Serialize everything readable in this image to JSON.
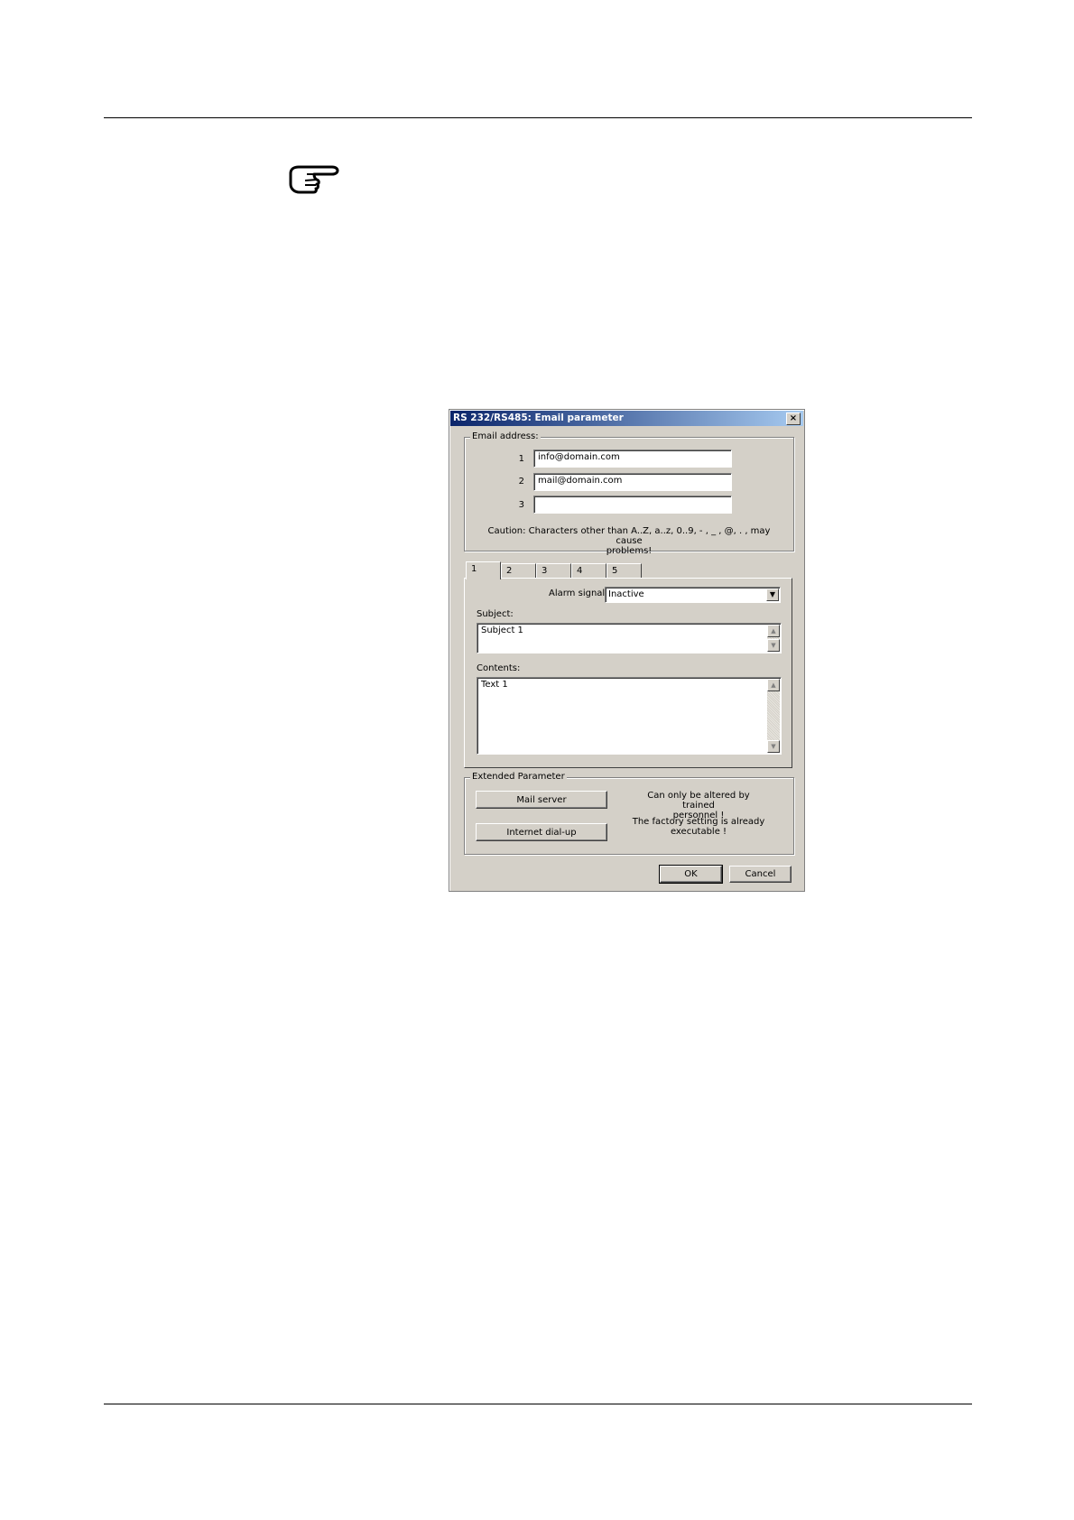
{
  "dialog": {
    "title": "RS 232/RS485: Email parameter",
    "close_glyph": "×"
  },
  "email_group": {
    "legend": "Email address:",
    "rows": [
      {
        "num": "1",
        "value": "info@domain.com"
      },
      {
        "num": "2",
        "value": "mail@domain.com"
      },
      {
        "num": "3",
        "value": ""
      }
    ],
    "caution_line1": "Caution: Characters other than A..Z, a..z, 0..9, - , _ , @, . , may cause",
    "caution_line2": "problems!"
  },
  "tabs": [
    "1",
    "2",
    "3",
    "4",
    "5"
  ],
  "tab_panel": {
    "alarm_label": "Alarm signal:",
    "alarm_value": "Inactive",
    "subject_label": "Subject:",
    "subject_value": "Subject 1",
    "contents_label": "Contents:",
    "contents_value": "Text 1"
  },
  "extended": {
    "legend": "Extended Parameter",
    "mail_server_label": "Mail server",
    "internet_dialup_label": "Internet dial-up",
    "note1_line1": "Can only be altered by trained",
    "note1_line2": "personnel !",
    "note2_line1": "The factory setting is already",
    "note2_line2": "executable !"
  },
  "footer": {
    "ok_label": "OK",
    "cancel_label": "Cancel"
  },
  "icons": {
    "hint": "pointing-hand-icon"
  }
}
